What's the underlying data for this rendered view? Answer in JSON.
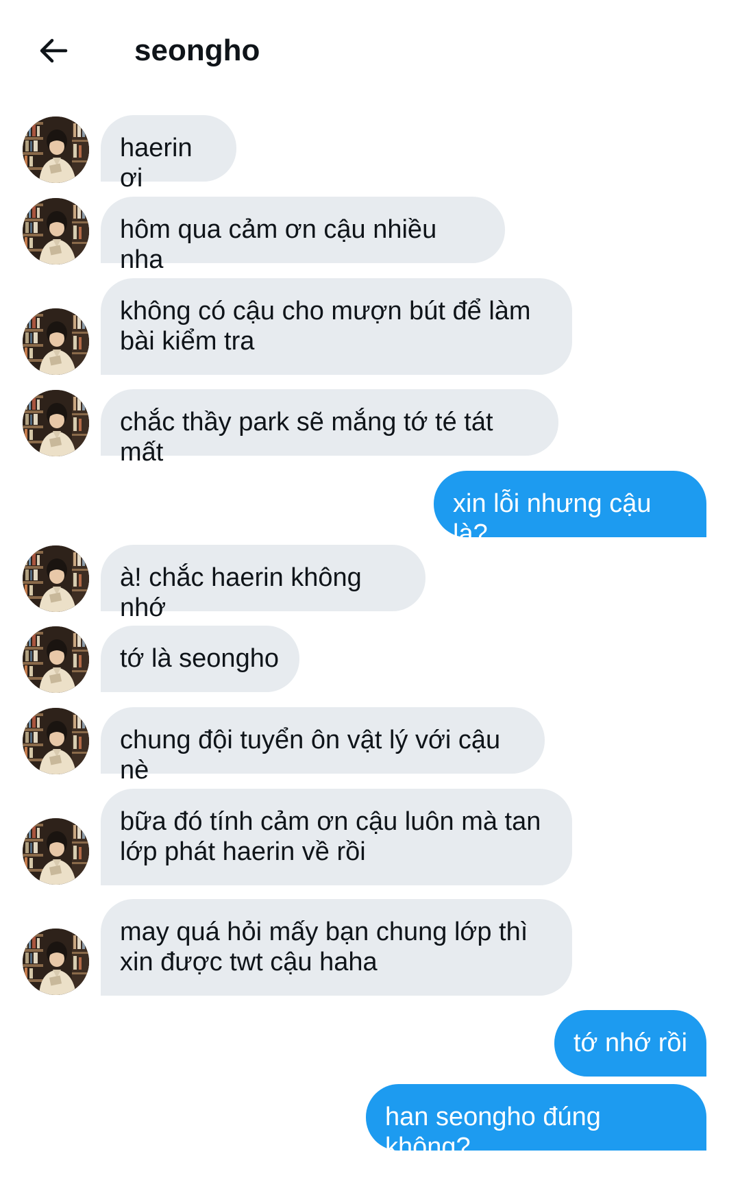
{
  "header": {
    "title": "seongho",
    "back_icon": "arrow-left-icon"
  },
  "colors": {
    "incoming_bubble": "#e7ebef",
    "outgoing_bubble": "#1d9bf0",
    "text": "#0f1419"
  },
  "messages": [
    {
      "sender": "seongho",
      "text": "haerin ơi"
    },
    {
      "sender": "seongho",
      "text": "hôm qua cảm ơn cậu nhiều nha"
    },
    {
      "sender": "seongho",
      "text": "không có cậu cho mượn bút để làm bài kiểm tra"
    },
    {
      "sender": "seongho",
      "text": "chắc thầy park sẽ mắng tớ té tát mất"
    },
    {
      "sender": "me",
      "text": "xin lỗi nhưng cậu là?"
    },
    {
      "sender": "seongho",
      "text": "à! chắc haerin không nhớ"
    },
    {
      "sender": "seongho",
      "text": "tớ là seongho"
    },
    {
      "sender": "seongho",
      "text": "chung đội tuyển ôn vật lý với cậu nè"
    },
    {
      "sender": "seongho",
      "text": "bữa đó tính cảm ơn cậu luôn mà tan lớp phát haerin về rồi"
    },
    {
      "sender": "seongho",
      "text": "may quá hỏi mấy bạn chung lớp thì xin được twt cậu haha"
    },
    {
      "sender": "me",
      "text": "tớ nhớ rồi"
    },
    {
      "sender": "me",
      "text": "han seongho đúng không?"
    }
  ]
}
